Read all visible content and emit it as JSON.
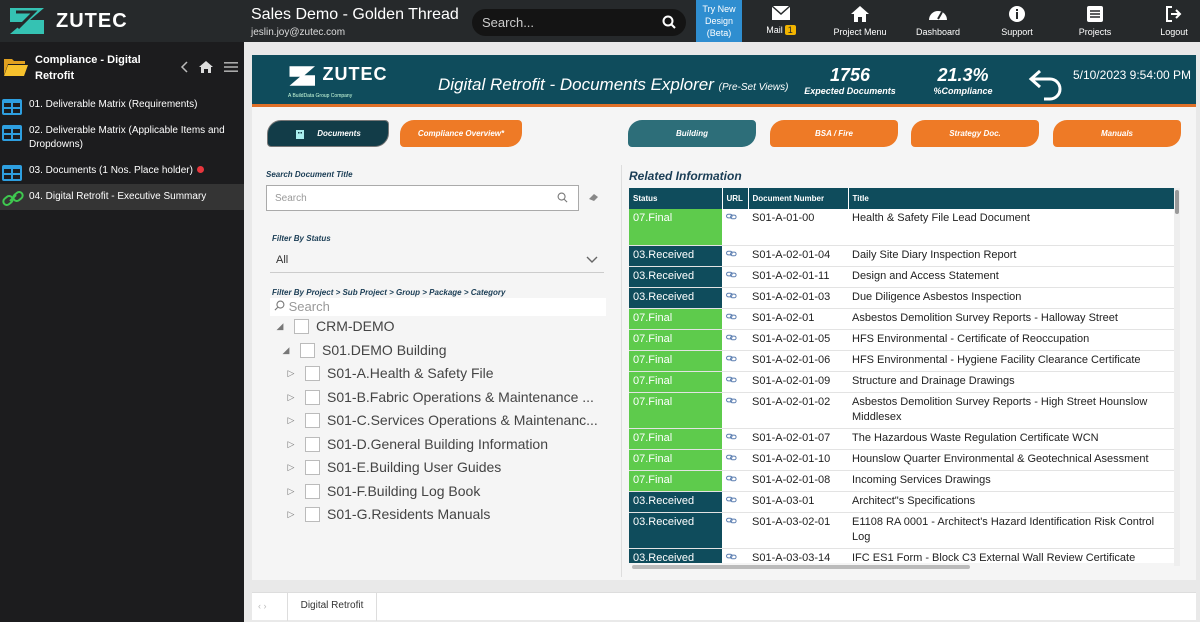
{
  "app": {
    "logo_text": "ZUTEC",
    "project_title": "Sales Demo - Golden Thread",
    "user_email": "jeslin.joy@zutec.com"
  },
  "search": {
    "placeholder": "Search..."
  },
  "try_new": {
    "line1": "Try New",
    "line2": "Design",
    "line3": "(Beta)"
  },
  "nav": {
    "mail": "Mail",
    "mail_count": "1",
    "project_menu": "Project Menu",
    "dashboard": "Dashboard",
    "support": "Support",
    "projects": "Projects",
    "logout": "Logout"
  },
  "sidebar": {
    "header": "Compliance - Digital Retrofit",
    "items": [
      {
        "label": "01. Deliverable Matrix (Requirements)"
      },
      {
        "label": "02. Deliverable Matrix (Applicable Items and Dropdowns)"
      },
      {
        "label": "03. Documents (1 Nos. Place holder)"
      },
      {
        "label": "04. Digital Retrofit - Executive Summary"
      }
    ]
  },
  "report": {
    "logo_text": "ZUTEC",
    "logo_sub": "A BuildData Group Company",
    "title": "Digital Retrofit - Documents Explorer",
    "title_suffix": "(Pre-Set Views)",
    "kpi_docs_value": "1756",
    "kpi_docs_label": "Expected Documents",
    "kpi_compliance_value": "21.3%",
    "kpi_compliance_label": "%Compliance",
    "date": "5/10/2023 9:54:00 PM",
    "buttons": {
      "documents": "Documents",
      "compliance": "Compliance Overview*",
      "building": "Building",
      "bsa": "BSA / Fire",
      "strategy": "Strategy Doc.",
      "manuals": "Manuals"
    },
    "search_label": "Search Document Title",
    "search_placeholder": "Search",
    "status_label": "Filter By Status",
    "status_value": "All",
    "tree_label": "Filter By Project > Sub Project > Group > Package > Category",
    "tree_search_placeholder": "Search",
    "tree": [
      {
        "label": "CRM-DEMO",
        "toggle": "◢"
      },
      {
        "label": "S01.DEMO Building",
        "toggle": "◢"
      },
      {
        "label": "S01-A.Health & Safety File",
        "toggle": "▷"
      },
      {
        "label": "S01-B.Fabric Operations & Maintenance ...",
        "toggle": "▷"
      },
      {
        "label": "S01-C.Services Operations & Maintenanc...",
        "toggle": "▷"
      },
      {
        "label": "S01-D.General Building Information",
        "toggle": "▷"
      },
      {
        "label": "S01-E.Building User Guides",
        "toggle": "▷"
      },
      {
        "label": "S01-F.Building Log Book",
        "toggle": "▷"
      },
      {
        "label": "S01-G.Residents Manuals",
        "toggle": "▷"
      }
    ],
    "related_title": "Related Information",
    "columns": [
      "Status",
      "URL",
      "Document Number",
      "Title"
    ],
    "rows": [
      {
        "status": "07.Final",
        "number": "S01-A-01-00",
        "title": "Health & Safety File Lead Document"
      },
      {
        "status": "03.Received",
        "number": "S01-A-02-01-04",
        "title": "Daily Site Diary Inspection Report"
      },
      {
        "status": "03.Received",
        "number": "S01-A-02-01-11",
        "title": "Design and Access Statement"
      },
      {
        "status": "03.Received",
        "number": "S01-A-02-01-03",
        "title": "Due Diligence Asbestos Inspection"
      },
      {
        "status": "07.Final",
        "number": "S01-A-02-01",
        "title": "Asbestos Demolition Survey Reports - Halloway Street"
      },
      {
        "status": "07.Final",
        "number": "S01-A-02-01-05",
        "title": "HFS Environmental - Certificate of Reoccupation"
      },
      {
        "status": "07.Final",
        "number": "S01-A-02-01-06",
        "title": "HFS Environmental - Hygiene Facility Clearance Certificate"
      },
      {
        "status": "07.Final",
        "number": "S01-A-02-01-09",
        "title": "Structure and Drainage Drawings"
      },
      {
        "status": "07.Final",
        "number": "S01-A-02-01-02",
        "title": "Asbestos Demolition Survey Reports - High Street Hounslow Middlesex"
      },
      {
        "status": "07.Final",
        "number": "S01-A-02-01-07",
        "title": "The Hazardous Waste Regulation Certificate WCN"
      },
      {
        "status": "07.Final",
        "number": "S01-A-02-01-10",
        "title": "Hounslow Quarter Environmental & Geotechnical Asessment"
      },
      {
        "status": "07.Final",
        "number": "S01-A-02-01-08",
        "title": "Incoming Services Drawings"
      },
      {
        "status": "03.Received",
        "number": "S01-A-03-01",
        "title": "Architect\"s Specifications"
      },
      {
        "status": "03.Received",
        "number": "S01-A-03-02-01",
        "title": "E1108 RA 0001 - Architect's Hazard Identification Risk Control Log"
      },
      {
        "status": "03.Received",
        "number": "S01-A-03-03-14",
        "title": "IFC ES1 Form - Block C3 External Wall Review Certificate"
      }
    ]
  },
  "bottom": {
    "nav_arrows": "‹  ›",
    "page_tab": "Digital Retrofit"
  },
  "colors": {
    "final": "#5ecb4c",
    "received": "#0f4c5c",
    "orange": "#ee7a26",
    "teal": "#2d6e79"
  }
}
